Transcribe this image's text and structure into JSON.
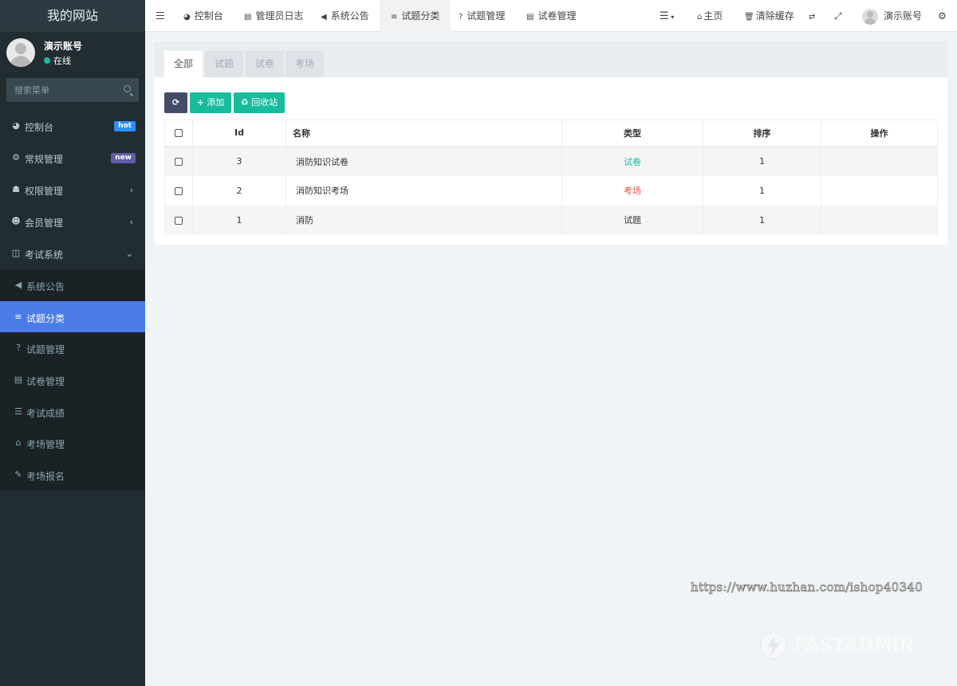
{
  "brand": "我的网站",
  "user": {
    "name": "演示账号",
    "status": "在线"
  },
  "search": {
    "placeholder": "搜索菜单"
  },
  "sidebar": {
    "items": [
      {
        "label": "控制台",
        "icon": "dashboard-icon",
        "badge": "hot"
      },
      {
        "label": "常规管理",
        "icon": "cogs-icon",
        "badge": "new"
      },
      {
        "label": "权限管理",
        "icon": "group-icon"
      },
      {
        "label": "会员管理",
        "icon": "user-circle-icon"
      },
      {
        "label": "考试系统",
        "icon": "columns-icon"
      }
    ],
    "sub": [
      {
        "label": "系统公告",
        "icon": "volume-icon"
      },
      {
        "label": "试题分类",
        "icon": "align-left-icon",
        "active": true
      },
      {
        "label": "试题管理",
        "icon": "question-icon"
      },
      {
        "label": "试卷管理",
        "icon": "keyboard-icon"
      },
      {
        "label": "考试成绩",
        "icon": "list-icon"
      },
      {
        "label": "考场管理",
        "icon": "home-icon"
      },
      {
        "label": "考场报名",
        "icon": "pencil-icon"
      }
    ]
  },
  "nav": {
    "tabs": [
      "控制台",
      "管理员日志",
      "系统公告",
      "试题分类",
      "试题管理",
      "试卷管理"
    ],
    "home": "主页",
    "clear_cache": "清除缓存",
    "user": "演示账号"
  },
  "content": {
    "tabs": [
      "全部",
      "试题",
      "试卷",
      "考场"
    ],
    "buttons": {
      "add": "添加",
      "recycle": "回收站"
    },
    "columns": [
      "Id",
      "名称",
      "类型",
      "排序",
      "操作"
    ],
    "rows": [
      {
        "id": "3",
        "name": "消防知识试卷",
        "type": "试卷",
        "type_color": "#18bc9c",
        "order": "1"
      },
      {
        "id": "2",
        "name": "消防知识考场",
        "type": "考场",
        "type_color": "#e74c3c",
        "order": "1"
      },
      {
        "id": "1",
        "name": "消防",
        "type": "试题",
        "type_color": "#333333",
        "order": "1"
      }
    ]
  },
  "watermark": "https://www.huzhan.com/ishop40340",
  "watermark_logo_text": "FASTADMIN"
}
